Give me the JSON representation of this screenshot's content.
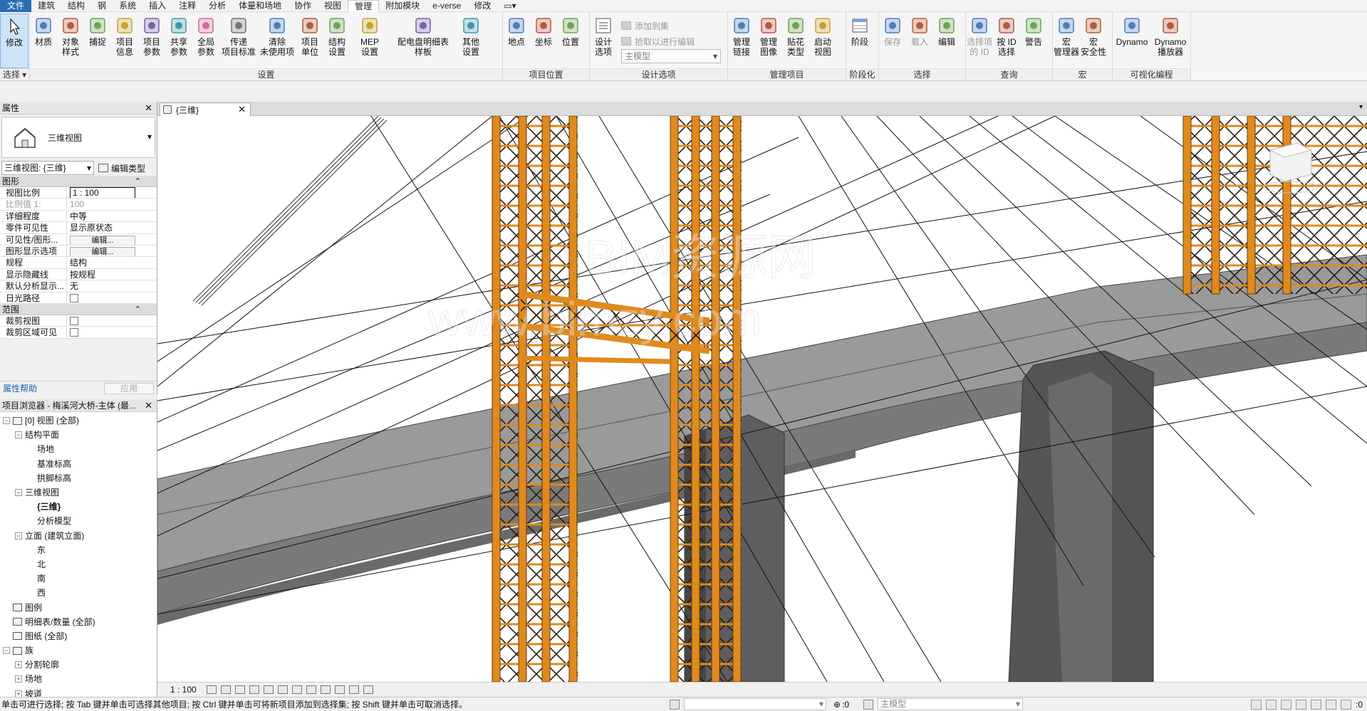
{
  "menubar": {
    "tabs": [
      "文件",
      "建筑",
      "结构",
      "钢",
      "系统",
      "插入",
      "注释",
      "分析",
      "体量和场地",
      "协作",
      "视图",
      "管理",
      "附加模块",
      "e-verse",
      "修改"
    ],
    "active": "管理",
    "extra_icon": "quick-access-dropdown-icon"
  },
  "ribbon": {
    "select": {
      "title": "选择 ▾",
      "modify": "修改"
    },
    "settings": {
      "title": "设置",
      "buttons": [
        "材质",
        "对象\n样式",
        "捕捉",
        "项目\n信息",
        "项目\n参数",
        "共享\n参数",
        "全局\n参数",
        "传递\n项目标准",
        "清除\n未使用项",
        "项目\n单位",
        "结构\n设置",
        "MEP\n设置",
        "配电盘明细表\n样板",
        "其他\n设置"
      ]
    },
    "location": {
      "title": "项目位置",
      "buttons": [
        "地点",
        "坐标",
        "位置"
      ]
    },
    "design_options": {
      "title": "设计选项",
      "button": "设计\n选项",
      "add_to_set": "添加到集",
      "pick_to_edit": "拾取以进行编辑",
      "combo": "主模型"
    },
    "manage_project": {
      "title": "管理项目",
      "buttons": [
        "管理\n链接",
        "管理\n图像",
        "贴花\n类型",
        "启动\n视图"
      ]
    },
    "phasing": {
      "title": "阶段化",
      "button": "阶段"
    },
    "selection": {
      "title": "选择",
      "buttons": [
        "保存",
        "载入",
        "编辑"
      ]
    },
    "inquiry": {
      "title": "查询",
      "buttons": [
        "选择项\n的 ID",
        "按 ID\n选择",
        "警告"
      ]
    },
    "macros": {
      "title": "宏",
      "buttons": [
        "宏\n管理器",
        "宏\n安全性"
      ]
    },
    "visual_programming": {
      "title": "可视化编程",
      "buttons": [
        "Dynamo",
        "Dynamo\n播放器"
      ]
    }
  },
  "properties": {
    "title": "属性",
    "type_name": "三维视图",
    "view_selector": "三维视图: {三维}",
    "edit_type": "编辑类型",
    "categories": {
      "graphics": "图形",
      "extents": "范围"
    },
    "rows": [
      {
        "name": "视图比例",
        "value": "1 : 100",
        "kind": "input"
      },
      {
        "name": "比例值 1:",
        "value": "100",
        "kind": "gray"
      },
      {
        "name": "详细程度",
        "value": "中等",
        "kind": "text"
      },
      {
        "name": "零件可见性",
        "value": "显示原状态",
        "kind": "text"
      },
      {
        "name": "可见性/图形...",
        "value": "编辑...",
        "kind": "button"
      },
      {
        "name": "图形显示选项",
        "value": "编辑...",
        "kind": "button"
      },
      {
        "name": "规程",
        "value": "结构",
        "kind": "text"
      },
      {
        "name": "显示隐藏线",
        "value": "按规程",
        "kind": "text"
      },
      {
        "name": "默认分析显示...",
        "value": "无",
        "kind": "text"
      },
      {
        "name": "日光路径",
        "value": "",
        "kind": "check"
      }
    ],
    "extent_rows": [
      {
        "name": "裁剪视图",
        "value": "",
        "kind": "check"
      },
      {
        "name": "裁剪区域可见",
        "value": "",
        "kind": "check"
      }
    ],
    "help": "属性帮助",
    "apply": "应用"
  },
  "browser": {
    "title": "项目浏览器 - 梅溪河大桥-主体 (最...",
    "nodes": [
      {
        "label": "[0] 视图 (全部)",
        "level": 0,
        "toggle": "−"
      },
      {
        "label": "结构平面",
        "level": 1,
        "toggle": "−"
      },
      {
        "label": "场地",
        "level": 2,
        "toggle": ""
      },
      {
        "label": "基准标高",
        "level": 2,
        "toggle": ""
      },
      {
        "label": "拱脚标高",
        "level": 2,
        "toggle": ""
      },
      {
        "label": "三维视图",
        "level": 1,
        "toggle": "−"
      },
      {
        "label": "{三维}",
        "level": 2,
        "toggle": "",
        "bold": true
      },
      {
        "label": "分析模型",
        "level": 2,
        "toggle": ""
      },
      {
        "label": "立面 (建筑立面)",
        "level": 1,
        "toggle": "−"
      },
      {
        "label": "东",
        "level": 2,
        "toggle": ""
      },
      {
        "label": "北",
        "level": 2,
        "toggle": ""
      },
      {
        "label": "南",
        "level": 2,
        "toggle": ""
      },
      {
        "label": "西",
        "level": 2,
        "toggle": ""
      },
      {
        "label": "图例",
        "level": 0,
        "toggle": ""
      },
      {
        "label": "明细表/数量 (全部)",
        "level": 0,
        "toggle": ""
      },
      {
        "label": "图纸 (全部)",
        "level": 0,
        "toggle": ""
      },
      {
        "label": "族",
        "level": 0,
        "toggle": "−"
      },
      {
        "label": "分割轮廓",
        "level": 1,
        "toggle": "+"
      },
      {
        "label": "场地",
        "level": 1,
        "toggle": "+"
      },
      {
        "label": "坡道",
        "level": 1,
        "toggle": "+"
      }
    ]
  },
  "document": {
    "tab": "{三维}"
  },
  "viewbar": {
    "scale": "1 : 100"
  },
  "watermark": {
    "line1": "BIM资源网",
    "line2": "www.bimzy.com"
  },
  "status": {
    "message": "单击可进行选择; 按 Tab 键并单击可选择其他项目; 按 Ctrl 键并单击可将新项目添加到选择集; 按 Shift 键并单击可取消选择。",
    "workset_value": ":0",
    "model_combo": "主模型",
    "filter_value": ":0"
  },
  "colors": {
    "scaffold": "#e08a1e",
    "deck": "#8c8c8c",
    "pier": "#5a5a5a",
    "file_tab": "#2a6db5"
  }
}
